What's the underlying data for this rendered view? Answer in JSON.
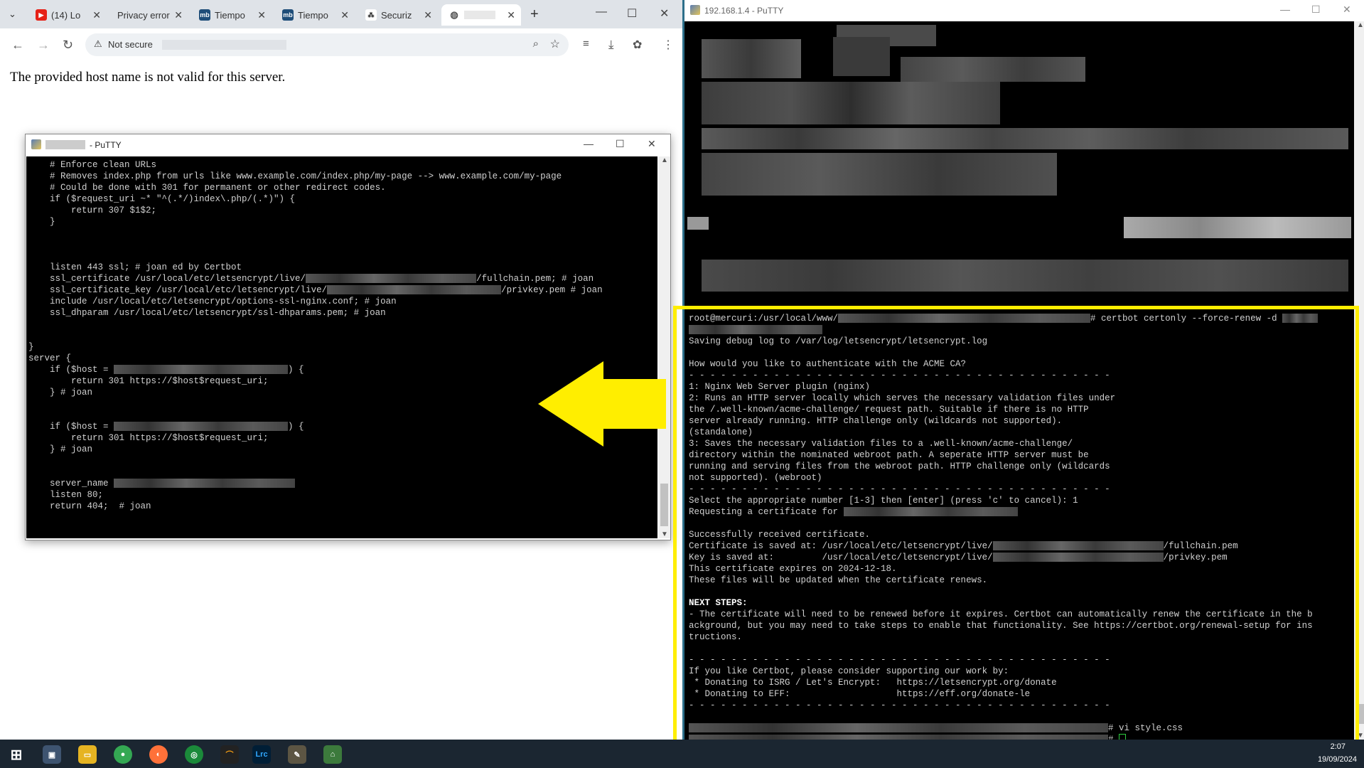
{
  "browser": {
    "tabs": [
      {
        "label": "(14) Lo"
      },
      {
        "label": "Privacy error"
      },
      {
        "label": "Tiempo"
      },
      {
        "label": "Tiempo"
      },
      {
        "label": "Securiz"
      },
      {
        "label": ""
      }
    ],
    "security_label": "Not secure",
    "page_message": "The provided host name is not valid for this server."
  },
  "putty_small": {
    "title": "- PuTTY",
    "lines": [
      "    # Enforce clean URLs",
      "    # Removes index.php from urls like www.example.com/index.php/my-page --> www.example.com/my-page",
      "    # Could be done with 301 for permanent or other redirect codes.",
      "    if ($request_uri ~* \"^(.*/)index\\.php/(.*)\") {",
      "        return 307 $1$2;",
      "    }",
      "",
      "",
      "",
      "    listen 443 ssl; # joan ed by Certbot",
      "    ssl_certificate /usr/local/etc/letsencrypt/live/",
      "    ssl_certificate_key /usr/local/etc/letsencrypt/live/",
      "    include /usr/local/etc/letsencrypt/options-ssl-nginx.conf; # joan",
      "    ssl_dhparam /usr/local/etc/letsencrypt/ssl-dhparams.pem; # joan",
      "",
      "",
      "}",
      "server {",
      "    if ($host = ",
      "        return 301 https://$host$request_uri;",
      "    } # joan",
      "",
      "",
      "    if ($host = ",
      "        return 301 https://$host$request_uri;",
      "    } # joan",
      "",
      "",
      "    server_name ",
      "    listen 80;",
      "    return 404;  # joan"
    ],
    "suffix_fullchain": "/fullchain.pem; # joan",
    "suffix_privkey": "/privkey.pem # joan",
    "suffix_host": ") {"
  },
  "putty_main": {
    "title": "192.168.1.4 - PuTTY",
    "prompt_prefix": "root@mercuri:/usr/local/www/",
    "command": "# certbot certonly --force-renew -d",
    "output": [
      "Saving debug log to /var/log/letsencrypt/letsencrypt.log",
      "",
      "How would you like to authenticate with the ACME CA?",
      "- - - - - - - - - - - - - - - - - - - - - - - - - - - - - - - - - - - - - - - -",
      "1: Nginx Web Server plugin (nginx)",
      "2: Runs an HTTP server locally which serves the necessary validation files under",
      "the /.well-known/acme-challenge/ request path. Suitable if there is no HTTP",
      "server already running. HTTP challenge only (wildcards not supported).",
      "(standalone)",
      "3: Saves the necessary validation files to a .well-known/acme-challenge/",
      "directory within the nominated webroot path. A seperate HTTP server must be",
      "running and serving files from the webroot path. HTTP challenge only (wildcards",
      "not supported). (webroot)",
      "- - - - - - - - - - - - - - - - - - - - - - - - - - - - - - - - - - - - - - - -",
      "Select the appropriate number [1-3] then [enter] (press 'c' to cancel): 1",
      "Requesting a certificate for ",
      "",
      "Successfully received certificate.",
      "Certificate is saved at: /usr/local/etc/letsencrypt/live/",
      "Key is saved at:         /usr/local/etc/letsencrypt/live/",
      "This certificate expires on 2024-12-18.",
      "These files will be updated when the certificate renews.",
      "",
      "NEXT STEPS:",
      "- The certificate will need to be renewed before it expires. Certbot can automatically renew the certificate in the b",
      "ackground, but you may need to take steps to enable that functionality. See https://certbot.org/renewal-setup for ins",
      "tructions.",
      "",
      "- - - - - - - - - - - - - - - - - - - - - - - - - - - - - - - - - - - - - - - -",
      "If you like Certbot, please consider supporting our work by:",
      " * Donating to ISRG / Let's Encrypt:   https://letsencrypt.org/donate",
      " * Donating to EFF:                    https://eff.org/donate-le",
      "- - - - - - - - - - - - - - - - - - - - - - - - - - - - - - - - - - - - - - - -"
    ],
    "suffix_fullchain": "/fullchain.pem",
    "suffix_privkey": "/privkey.pem",
    "last_cmd": "# vi style.css",
    "prompt_end": "#"
  },
  "taskbar": {
    "time": "2:07",
    "date": "19/09/2024"
  },
  "colors": {
    "highlight": "#ffee00",
    "arrow": "#ffee00"
  }
}
